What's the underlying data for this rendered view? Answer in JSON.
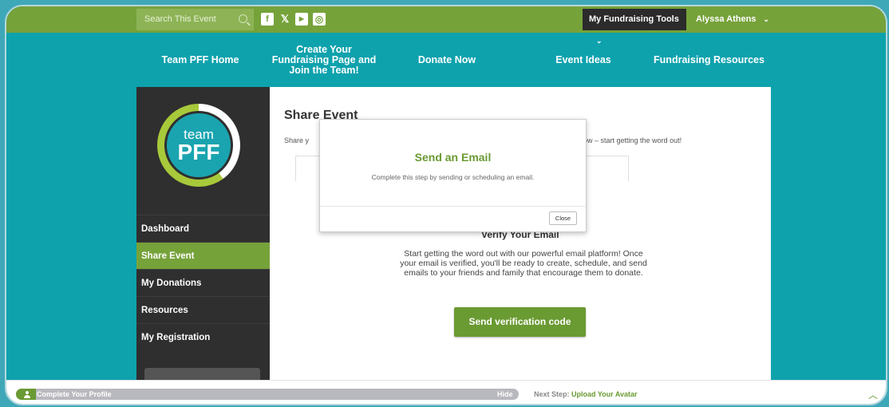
{
  "topbar": {
    "search_placeholder": "Search This Event",
    "social": [
      {
        "icon": "facebook-icon",
        "glyph": "f"
      },
      {
        "icon": "x-icon",
        "glyph": "𝕏"
      },
      {
        "icon": "youtube-icon",
        "glyph": "▶"
      },
      {
        "icon": "instagram-icon",
        "glyph": "◎"
      }
    ],
    "tools_label": "My Fundraising Tools",
    "user_name": "Alyssa Athens"
  },
  "nav": {
    "items": [
      "Team PFF Home",
      "Create Your Fundraising Page and Join the Team!",
      "Donate Now",
      "Event Ideas",
      "Fundraising Resources"
    ]
  },
  "sidebar": {
    "logo_team": "team",
    "logo_pff": "PFF",
    "items": [
      {
        "label": "Dashboard",
        "active": false
      },
      {
        "label": "Share Event",
        "active": true
      },
      {
        "label": "My Donations",
        "active": false
      },
      {
        "label": "Resources",
        "active": false
      },
      {
        "label": "My Registration",
        "active": false
      }
    ]
  },
  "main": {
    "title": "Share Event",
    "subtitle_left": "Share y",
    "subtitle_right": "how – start getting the word out!",
    "verify_title": "Verify Your Email",
    "verify_text": "Start getting the word out with our powerful email platform! Once your email is verified, you'll be ready to create, schedule, and send emails to your friends and family that encourage them to donate.",
    "verify_button": "Send verification code"
  },
  "modal": {
    "title": "Send an Email",
    "text": "Complete this step by sending or scheduling an email.",
    "close_label": "Close"
  },
  "bottombar": {
    "profile_label": "Complete Your Profile",
    "hide_label": "Hide",
    "next_step_prefix": "Next Step: ",
    "next_step_link": "Upload Your Avatar"
  },
  "colors": {
    "teal": "#0ea2ad",
    "green": "#76a23a",
    "dark": "#2f2f2f"
  }
}
